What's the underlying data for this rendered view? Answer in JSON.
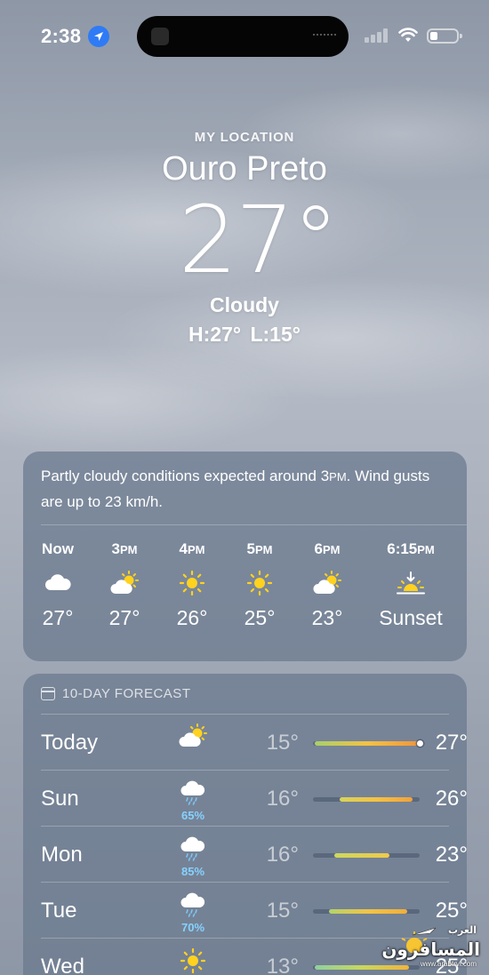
{
  "status_bar": {
    "time": "2:38"
  },
  "header": {
    "my_location": "MY LOCATION",
    "city": "Ouro Preto",
    "temperature": "27°",
    "condition": "Cloudy",
    "high_low": "H:27°  L:15°"
  },
  "hourly": {
    "summary_part1": "Partly cloudy conditions expected around 3",
    "summary_pm": "PM",
    "summary_part2": ". Wind gusts are up to 23 km/h.",
    "hours": [
      {
        "label": "Now",
        "suffix": "",
        "icon": "cloud-icon",
        "temp": "27°"
      },
      {
        "label": "3",
        "suffix": "PM",
        "icon": "partly-cloudy-icon",
        "temp": "27°"
      },
      {
        "label": "4",
        "suffix": "PM",
        "icon": "sun-icon",
        "temp": "26°"
      },
      {
        "label": "5",
        "suffix": "PM",
        "icon": "sun-icon",
        "temp": "25°"
      },
      {
        "label": "6",
        "suffix": "PM",
        "icon": "partly-cloudy-icon",
        "temp": "23°"
      },
      {
        "label": "6:15",
        "suffix": "PM",
        "icon": "sunset-icon",
        "temp": "Sunset"
      }
    ]
  },
  "forecast": {
    "title": "10-DAY FORECAST",
    "days": [
      {
        "day": "Today",
        "icon": "partly-cloudy-icon",
        "precip": "",
        "low": "15°",
        "high": "27°",
        "range_start": 0.02,
        "range_end": 1.0,
        "current": 1.0,
        "colors": [
          "#a8d06a",
          "#f5c242",
          "#f2963a"
        ]
      },
      {
        "day": "Sun",
        "icon": "rain-cloud-icon",
        "precip": "65%",
        "low": "16°",
        "high": "26°",
        "range_start": 0.25,
        "range_end": 0.93,
        "colors": [
          "#d6d45a",
          "#f5c242",
          "#f2a23a"
        ]
      },
      {
        "day": "Mon",
        "icon": "rain-cloud-icon",
        "precip": "85%",
        "low": "16°",
        "high": "23°",
        "range_start": 0.2,
        "range_end": 0.72,
        "colors": [
          "#cdd85e",
          "#f0ca48"
        ]
      },
      {
        "day": "Tue",
        "icon": "rain-cloud-icon",
        "precip": "70%",
        "low": "15°",
        "high": "25°",
        "range_start": 0.15,
        "range_end": 0.88,
        "colors": [
          "#b4d46a",
          "#f2c444",
          "#f2ae3a"
        ]
      },
      {
        "day": "Wed",
        "icon": "sun-icon",
        "precip": "",
        "low": "13°",
        "high": "25°",
        "range_start": 0.02,
        "range_end": 0.9,
        "colors": [
          "#8fd0a0",
          "#c8d85a",
          "#f2b43a"
        ]
      }
    ]
  },
  "watermark": {
    "arabic_small": "العرب",
    "arabic_main": "المسافرون",
    "url": "www.arabtrvl.com"
  }
}
